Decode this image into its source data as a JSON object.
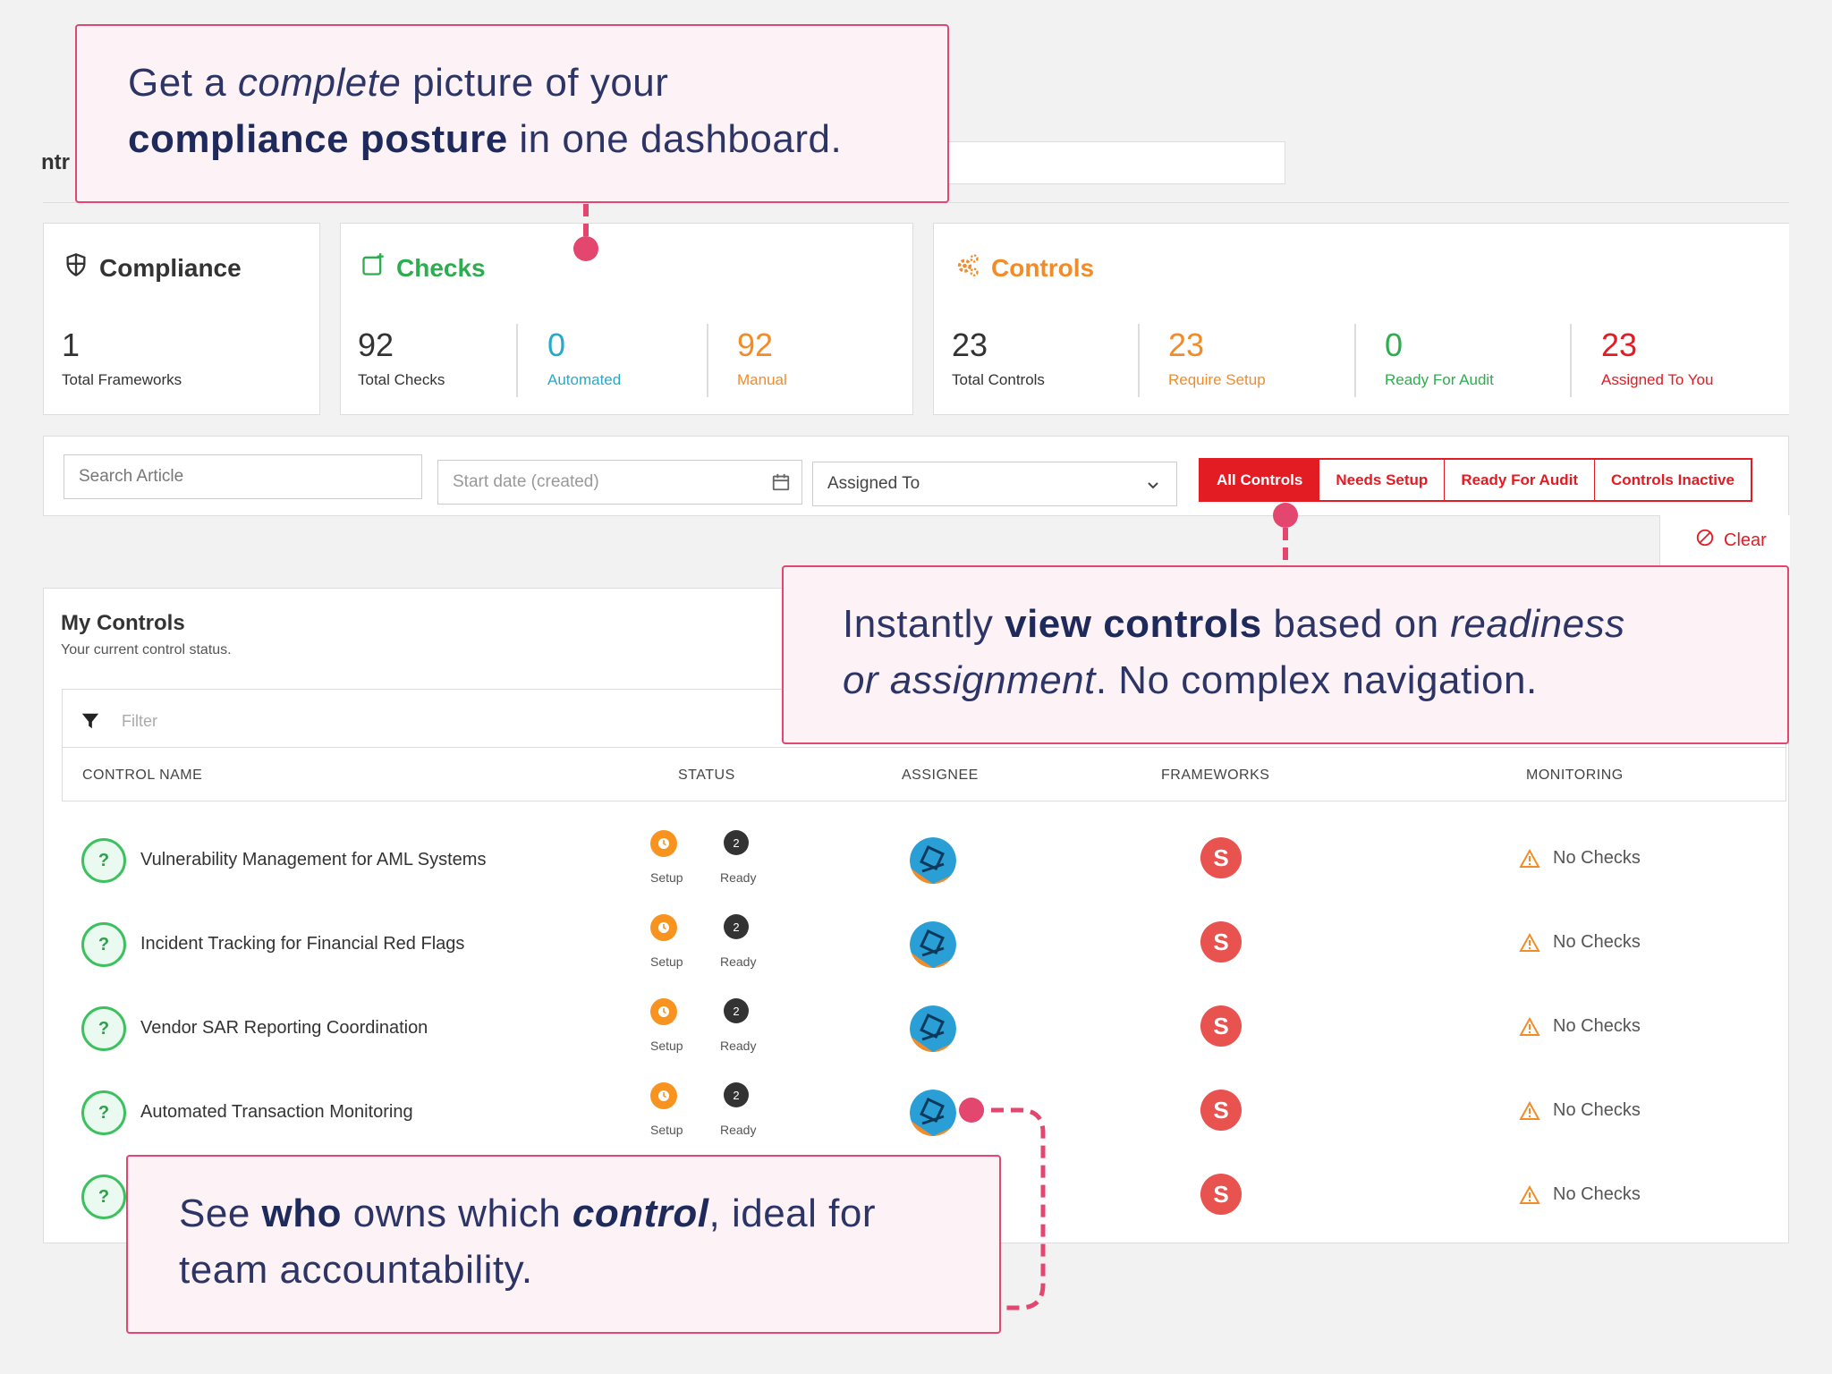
{
  "page": {
    "cropped_title": "ntr"
  },
  "cards": {
    "compliance": {
      "title": "Compliance",
      "stats": [
        {
          "num": "1",
          "label": "Total Frameworks"
        }
      ]
    },
    "checks": {
      "title": "Checks",
      "stats": [
        {
          "num": "92",
          "label": "Total Checks"
        },
        {
          "num": "0",
          "label": "Automated"
        },
        {
          "num": "92",
          "label": "Manual"
        }
      ]
    },
    "controls": {
      "title": "Controls",
      "stats": [
        {
          "num": "23",
          "label": "Total Controls"
        },
        {
          "num": "23",
          "label": "Require Setup"
        },
        {
          "num": "0",
          "label": "Ready For Audit"
        },
        {
          "num": "23",
          "label": "Assigned To You"
        }
      ]
    }
  },
  "filters": {
    "search_placeholder": "Search Article",
    "date_placeholder": "Start date (created)",
    "assigned_label": "Assigned To",
    "segments": [
      "All Controls",
      "Needs Setup",
      "Ready For Audit",
      "Controls Inactive"
    ],
    "clear_label": "Clear"
  },
  "my_controls": {
    "title": "My Controls",
    "subtitle": "Your current control status.",
    "filter_placeholder": "Filter",
    "columns": [
      "CONTROL NAME",
      "STATUS",
      "ASSIGNEE",
      "FRAMEWORKS",
      "MONITORING"
    ],
    "rows": [
      {
        "name": "Vulnerability Management for AML Systems",
        "setup_label": "Setup",
        "ready_count": "2",
        "ready_label": "Ready",
        "monitoring": "No Checks"
      },
      {
        "name": "Incident Tracking for Financial Red Flags",
        "setup_label": "Setup",
        "ready_count": "2",
        "ready_label": "Ready",
        "monitoring": "No Checks"
      },
      {
        "name": "Vendor SAR Reporting Coordination",
        "setup_label": "Setup",
        "ready_count": "2",
        "ready_label": "Ready",
        "monitoring": "No Checks"
      },
      {
        "name": "Automated Transaction Monitoring",
        "setup_label": "Setup",
        "ready_count": "2",
        "ready_label": "Ready",
        "monitoring": "No Checks"
      },
      {
        "monitoring": "No Checks"
      }
    ]
  },
  "callouts": {
    "top": {
      "l1a": "Get a ",
      "l1b": "complete",
      "l1c": " picture of your",
      "l2a": "compliance posture",
      "l2b": " in one dashboard."
    },
    "right": {
      "l1a": "Instantly ",
      "l1b": "view controls",
      "l1c": " based on ",
      "l1d": "readiness",
      "l2a": "or assignment",
      "l2b": ". No complex navigation."
    },
    "bottom": {
      "l1a": "See ",
      "l1b": "who",
      "l1c": " owns which ",
      "l1d": "control",
      "l1e": ", ideal for",
      "l2": "team accountability."
    }
  },
  "colors": {
    "green": "#2dad4f",
    "teal": "#29a9c9",
    "orange": "#f28c28",
    "red": "#e31b23",
    "pink": "#e3466f"
  }
}
